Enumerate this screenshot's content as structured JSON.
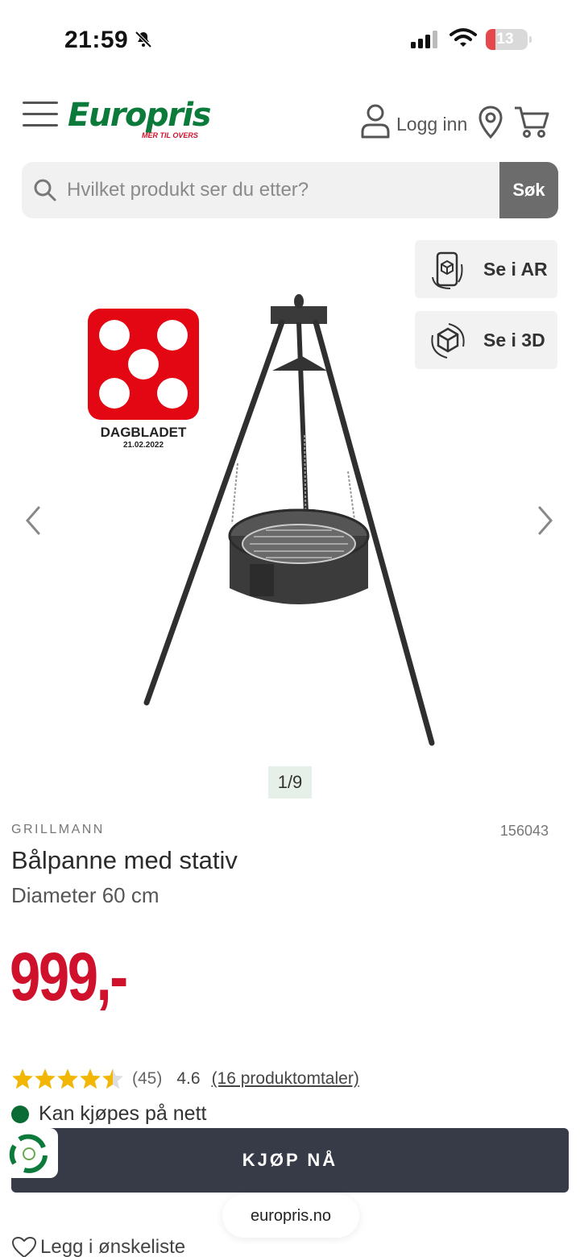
{
  "status_bar": {
    "time": "21:59",
    "battery_level": "13",
    "battery_color": "#e5484d"
  },
  "header": {
    "logo_text": "Europris",
    "logo_tagline": "MER TIL OVERS",
    "login_label": "Logg inn",
    "brand_color": "#0b7a3b"
  },
  "search": {
    "placeholder": "Hvilket produkt ser du etter?",
    "value": "",
    "button_label": "Søk"
  },
  "viewer_buttons": {
    "ar_label": "Se i AR",
    "view3d_label": "Se i 3D"
  },
  "award": {
    "name": "DAGBLADET",
    "date": "21.02.2022",
    "score": 5,
    "color": "#e30613"
  },
  "gallery": {
    "counter": "1/9"
  },
  "product": {
    "brand": "GRILLMANN",
    "sku": "156043",
    "title": "Bålpanne med stativ",
    "subtitle": "Diameter 60 cm",
    "price": "999,-",
    "price_color": "#d0112b",
    "rating": {
      "stars": 4.5,
      "review_count": "(45)",
      "average": "4.6",
      "reviews_link": "(16 produktomtaler)"
    },
    "availability": "Kan kjøpes på nett"
  },
  "actions": {
    "buy_label": "KJØP NÅ",
    "wishlist_label": "Legg i ønskeliste"
  },
  "browser": {
    "url": "europris.no"
  }
}
